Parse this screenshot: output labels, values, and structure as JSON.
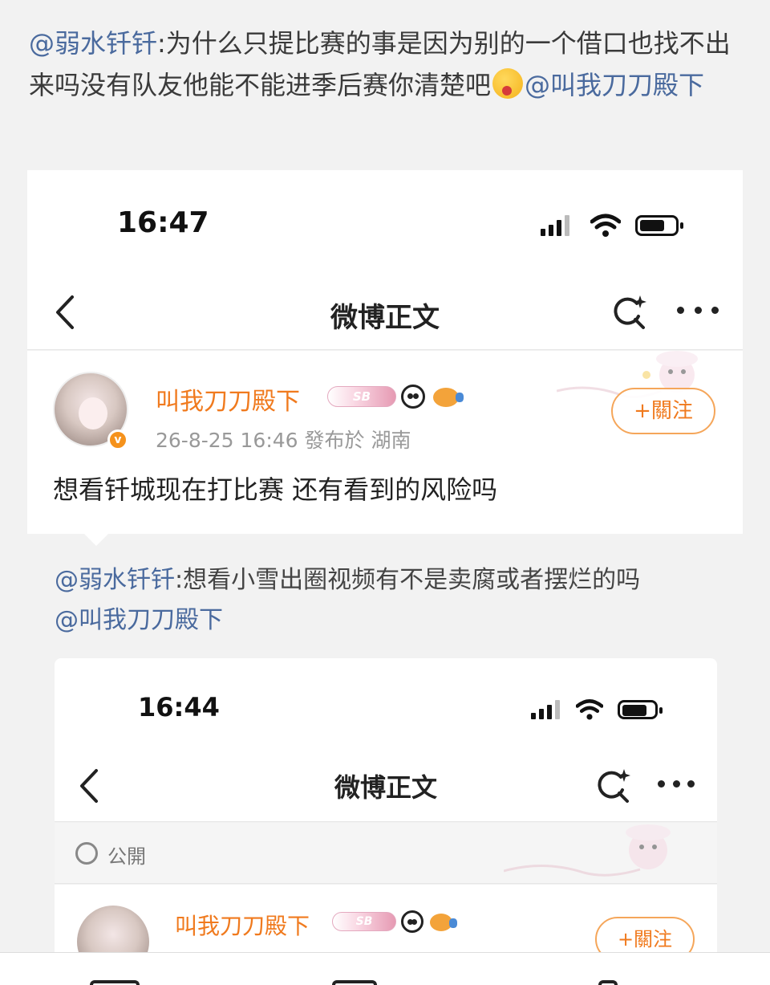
{
  "repost": {
    "mention1": "@弱水钎钎",
    "text": ":为什么只提比赛的事是因为别的一个借口也找不出来吗没有队友他能不能进季后赛你清楚吧",
    "mention2": "@叫我刀刀殿下"
  },
  "shot": {
    "status": {
      "time": "16:47"
    },
    "nav": {
      "title": "微博正文"
    },
    "post": {
      "username": "叫我刀刀殿下",
      "badge_text": "SB",
      "meta": "26-8-25 16:46  發布於 湖南",
      "follow_label": "+關注",
      "body": "想看钎城现在打比赛 还有看到的风险吗"
    },
    "inner_repost": {
      "mention1": "@弱水钎钎",
      "text": ":想看小雪出圈视频有不是卖腐或者摆烂的吗",
      "mention2": "@叫我刀刀殿下"
    },
    "inner_shot": {
      "status": {
        "time": "16:44"
      },
      "nav": {
        "title": "微博正文"
      },
      "visibility": "公開",
      "post": {
        "username": "叫我刀刀殿下",
        "badge_text": "SB",
        "follow_label": "+關注"
      }
    }
  },
  "colors": {
    "mention": "#4a6a9e",
    "username": "#f07a1e",
    "follow_border": "#f5a65a",
    "background": "#f2f2f2"
  },
  "icons": [
    "back-icon",
    "search-icon",
    "more-icon",
    "signal-icon",
    "wifi-icon",
    "battery-icon",
    "globe-icon",
    "verified-badge-icon",
    "panda-icon",
    "fish-icon"
  ]
}
